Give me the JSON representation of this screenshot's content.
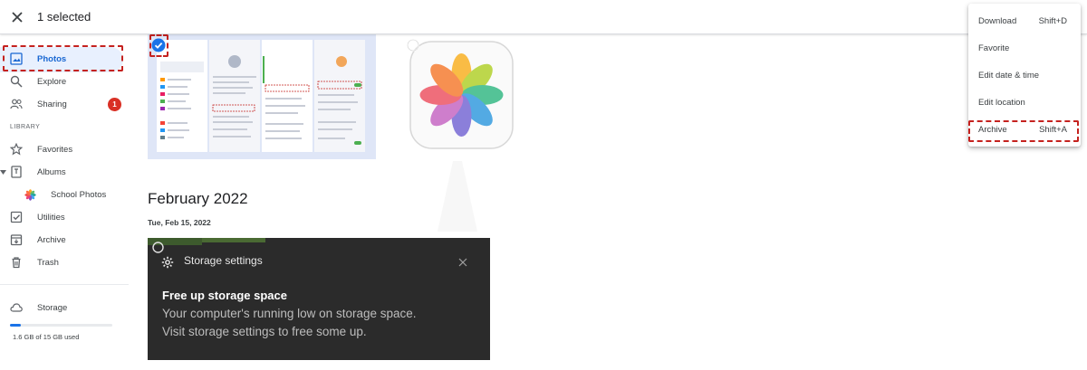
{
  "topbar": {
    "selection_text": "1 selected"
  },
  "sidebar": {
    "items": [
      {
        "label": "Photos"
      },
      {
        "label": "Explore"
      },
      {
        "label": "Sharing",
        "badge": "1"
      }
    ],
    "library_label": "LIBRARY",
    "library_items": [
      {
        "label": "Favorites"
      },
      {
        "label": "Albums"
      },
      {
        "label": "School Photos"
      },
      {
        "label": "Utilities"
      },
      {
        "label": "Archive"
      },
      {
        "label": "Trash"
      }
    ],
    "storage": {
      "label": "Storage",
      "used_text": "1.6 GB of 15 GB used",
      "used_fraction": 0.107
    }
  },
  "content": {
    "month_title": "February 2022",
    "date_label": "Tue, Feb 15, 2022",
    "storage_card": {
      "header": "Storage settings",
      "title": "Free up storage space",
      "line1": "Your computer's running low on storage space.",
      "line2": "Visit storage settings to free some up."
    }
  },
  "menu": {
    "items": [
      {
        "label": "Download",
        "shortcut": "Shift+D"
      },
      {
        "label": "Favorite",
        "shortcut": ""
      },
      {
        "label": "Edit date & time",
        "shortcut": ""
      },
      {
        "label": "Edit location",
        "shortcut": ""
      },
      {
        "label": "Archive",
        "shortcut": "Shift+A"
      }
    ]
  },
  "colors": {
    "accent": "#1a73e8",
    "active_bg": "#e8f0fe",
    "highlight_dash": "#c5221f",
    "badge": "#d93025"
  }
}
